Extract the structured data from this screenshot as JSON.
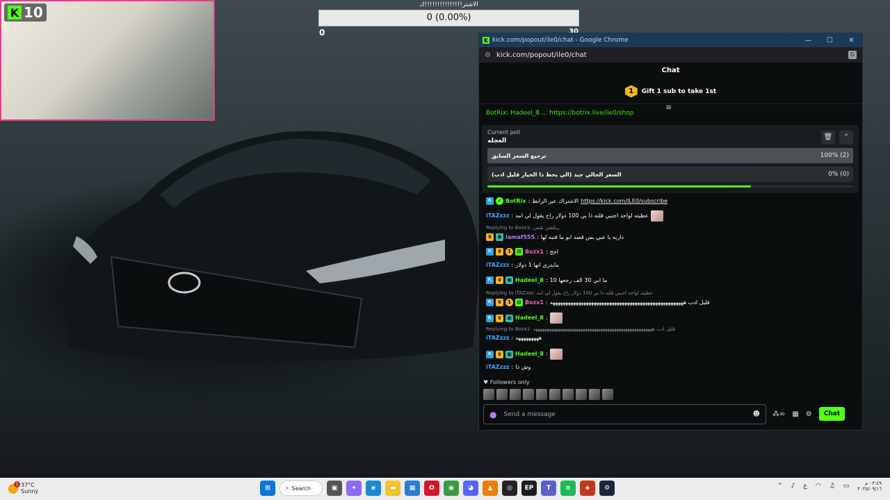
{
  "webcam": {
    "kick_count": "10"
  },
  "poll_overlay": {
    "title": "الاشتر!!!!!!!!!!!!!!!ك",
    "bar_text": "0 (0.00%)",
    "min_label": "0",
    "max_label": "30"
  },
  "window": {
    "title": "kick.com/popout/ile0/chat - Google Chrome",
    "url": "kick.com/popout/ile0/chat",
    "controls": {
      "minimize": "—",
      "maximize": "☐",
      "close": "✕"
    }
  },
  "chat": {
    "header": "Chat",
    "gift_rank": "1",
    "gift_text": "Gift 1 sub to take 1st",
    "pinned_text": "BotRix: Hadeel_8 ... https://botrix.live/ile0/shop",
    "poll": {
      "caption": "Current poll",
      "question": "العجله",
      "options": [
        {
          "label": "ترجيع السعر السابق",
          "result": "100% (2)",
          "fraction": 1.0
        },
        {
          "label": "السعر الحالي جيد (الي يحط ذا الخيار قليل ادب)",
          "result": "0% (0)",
          "fraction": 0
        }
      ],
      "timer_fraction": 0.72
    },
    "messages": [
      {
        "user": "BotRix",
        "sep": ":",
        "text": "الاشتراك عبر الرابط",
        "link": "https://kick.com/ILE0/subscribe",
        "color": "#53fc18"
      },
      {
        "user": "iTAZzzz",
        "sep": ":",
        "text": "عطيته لواحد اجنبي قلته ذا بي 100 دولار راح يقول لي امه",
        "color": "#4aa3ff"
      },
      {
        "reply": "Replying to Bozx1: ريكشن بلبعن"
      },
      {
        "user": "lamaf555",
        "sep": ":",
        "text": "داريه يا عبي بس قصد ابو ما قتبه لها",
        "color": "#b57cf7"
      },
      {
        "user": "Bozx1",
        "sep": ":",
        "text": "احح",
        "color": "#f05fbd"
      },
      {
        "user": "iTAZzzz",
        "sep": ":",
        "text": "مايدري انها 1 دولار",
        "color": "#4aa3ff"
      },
      {
        "user": "Hadeel_8",
        "sep": ":",
        "text": "ما ابي 30 الف رجعها 10",
        "color": "#53fc18"
      },
      {
        "reply": "Replying to iTAZzzz: عطيته لواحد اجنبي قلته ذا بي 100 دولار راح يقول لي امه"
      },
      {
        "user": "Bozx1",
        "sep": ":",
        "text": "قليل ادب ههههههههههههههههههههههههههههههههههههههههههههههههههههه",
        "color": "#f05fbd"
      },
      {
        "user": "Hadeel_8",
        "sep": ":",
        "text": "",
        "color": "#53fc18"
      },
      {
        "reply": "Replying to Bozx1: قليل ادب هههههههههههههههههههههههههههههههههههههههههههههههههههههه"
      },
      {
        "user": "iTAZzzz",
        "sep": ":",
        "text": "هههههههههه",
        "color": "#4aa3ff"
      },
      {
        "user": "Hadeel_8",
        "sep": ":",
        "text": "",
        "color": "#53fc18"
      },
      {
        "user": "iTAZzzz",
        "sep": ":",
        "text": "وش ذا",
        "color": "#4aa3ff"
      }
    ],
    "followers_only": "Followers only",
    "input_placeholder": "Send a message",
    "send_label": "Chat",
    "accent": "#53fc18"
  },
  "taskbar": {
    "temperature": "37°C",
    "condition": "Sunny",
    "weather_alert": "1",
    "search_label": "Search",
    "clock_time": "٠٣:٤٩ م",
    "clock_date": "٢٠٢٥/٠٩/١٦",
    "lang": "ع"
  }
}
